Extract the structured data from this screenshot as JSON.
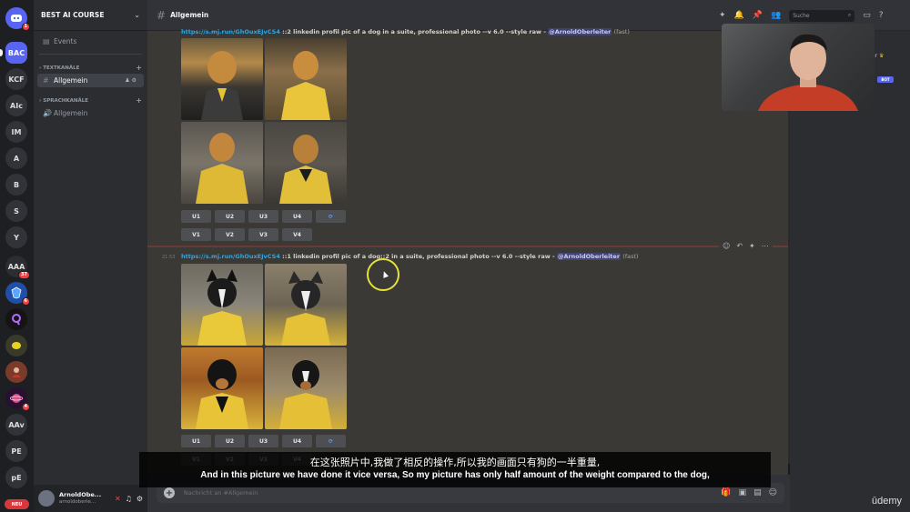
{
  "servers": [
    {
      "label": "",
      "icon": "discord-icon",
      "badge": "1"
    },
    {
      "label": "BAC",
      "active": true
    },
    {
      "label": "KCF"
    },
    {
      "label": "AIc"
    },
    {
      "label": "IM"
    },
    {
      "label": "A"
    },
    {
      "label": "B"
    },
    {
      "label": "S"
    },
    {
      "label": "Y"
    },
    {
      "label": "AAA",
      "badge": "37"
    },
    {
      "label": "",
      "badge": "6"
    },
    {
      "label": ""
    },
    {
      "label": ""
    },
    {
      "label": ""
    },
    {
      "label": "",
      "badge": "4"
    },
    {
      "label": "AAv"
    },
    {
      "label": "PE"
    },
    {
      "label": "pE"
    }
  ],
  "neu_label": "NEU",
  "sidebar": {
    "server_name": "BEST AI COURSE",
    "events_label": "Events",
    "text_category": "TEXTKANÄLE",
    "text_channel": "Allgemein",
    "voice_category": "SPRACHKANÄLE",
    "voice_channel": "Allgemein"
  },
  "user": {
    "name": "ArnoldObe...",
    "status": "arnoldoberle..."
  },
  "header": {
    "channel": "Allgemein",
    "search_placeholder": "Suche"
  },
  "messages": [
    {
      "link": "https://s.mj.run/GhOuxEJvCS4",
      "prompt": " ::2 linkedin profil pic of a dog in a suite, professional photo --v 6.0 --style raw - ",
      "mention": "@ArnoldOberleiter",
      "speed": "(fast)",
      "timestamp": "",
      "buttons_u": [
        "U1",
        "U2",
        "U3",
        "U4"
      ],
      "buttons_v": [
        "V1",
        "V2",
        "V3",
        "V4"
      ]
    },
    {
      "link": "https://s.mj.run/GhOuxEJvCS4",
      "prompt": " ::1 linkedin profil pic of a dog::2 in a suite, professional photo --v 6.0 --style raw - ",
      "mention": "@ArnoldOberleiter",
      "speed": "(fast)",
      "timestamp": "21:53",
      "buttons_u": [
        "U1",
        "U2",
        "U3",
        "U4"
      ],
      "buttons_v": [
        "V1",
        "V2",
        "V3",
        "V4"
      ]
    }
  ],
  "composer_placeholder": "Nachricht an #Allgemein",
  "member_fragment": "er",
  "bot_tag": "BOT",
  "subtitles": {
    "zh": "在这张照片中,我做了相反的操作,所以我的画面只有狗的一半重量,",
    "en": "And in this picture we have done it vice versa, So my picture has only half amount of the weight compared to the dog,"
  },
  "watermark": "ūdemy",
  "colors": {
    "blurple": "#5865f2",
    "link": "#2fa6e3",
    "subtitle_bg": "#000000"
  }
}
